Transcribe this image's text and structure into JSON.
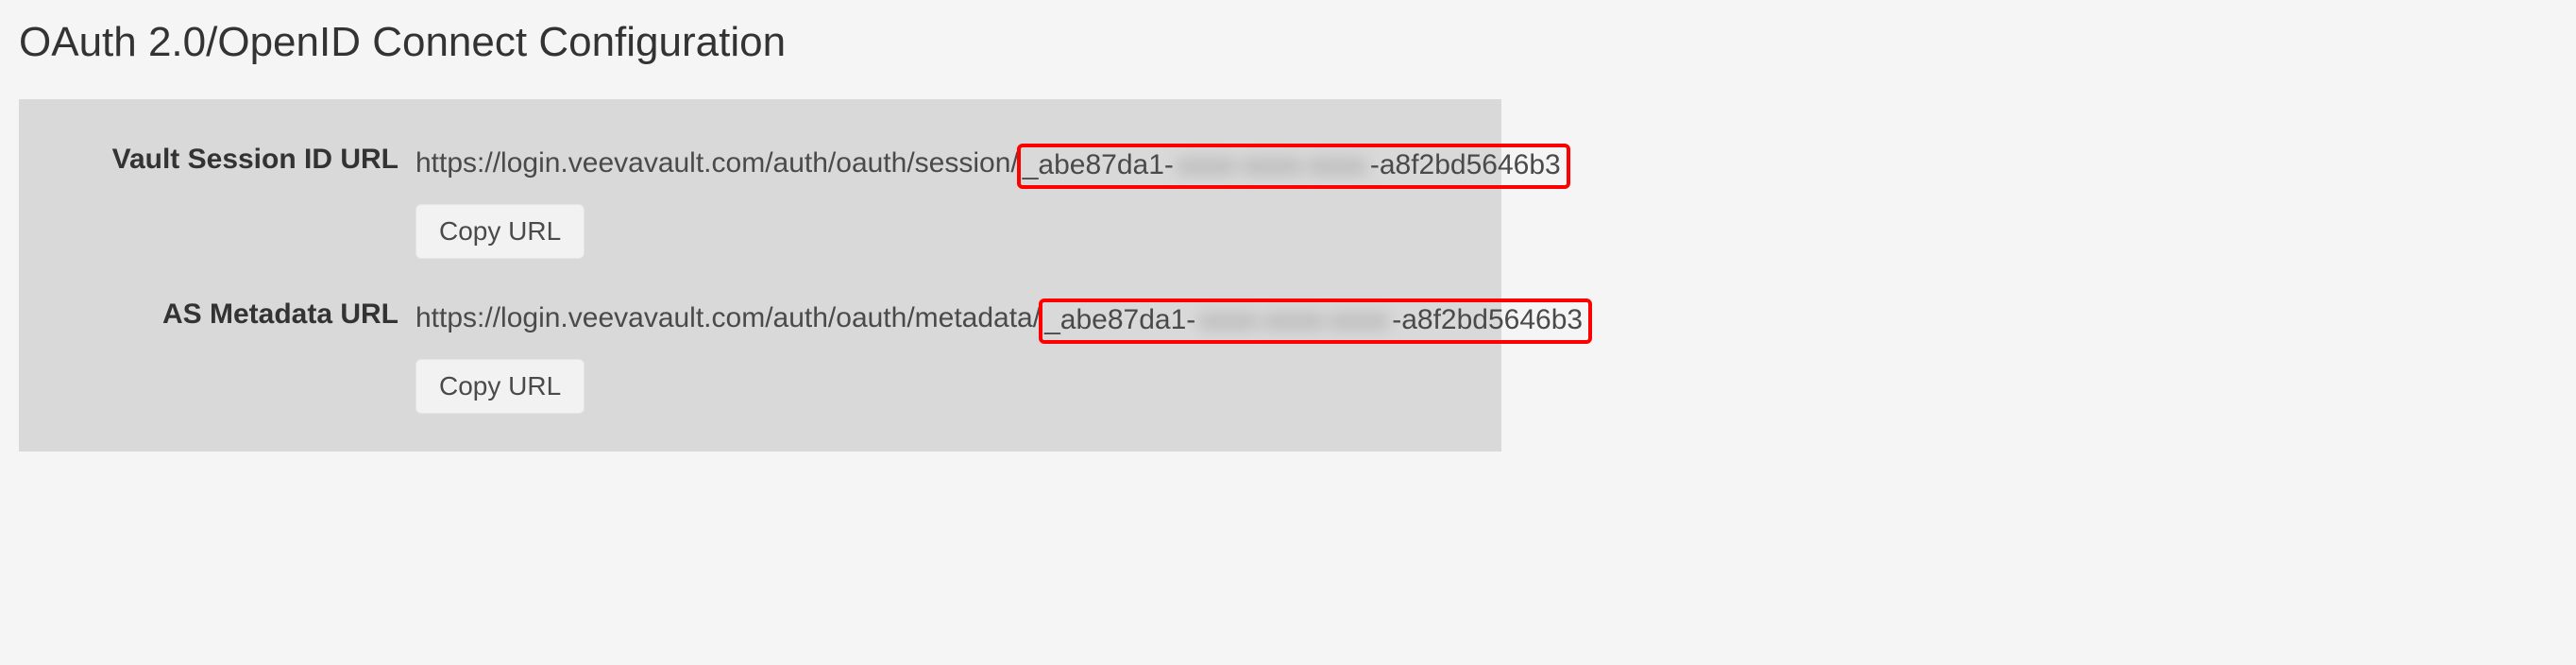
{
  "title": "OAuth 2.0/OpenID Connect Configuration",
  "rows": [
    {
      "label": "Vault Session ID URL",
      "url_prefix": "https://login.veevavault.com/auth/oauth/session/",
      "id_leading": "_abe87da1-",
      "id_redacted": "xxxx-xxxx-xxxx",
      "id_trailing": "-a8f2bd5646b3",
      "copy_label": "Copy URL"
    },
    {
      "label": "AS Metadata URL",
      "url_prefix": "https://login.veevavault.com/auth/oauth/metadata/",
      "id_leading": "_abe87da1-",
      "id_redacted": "xxxx-xxxx-xxxx",
      "id_trailing": "-a8f2bd5646b3",
      "copy_label": "Copy URL"
    }
  ]
}
